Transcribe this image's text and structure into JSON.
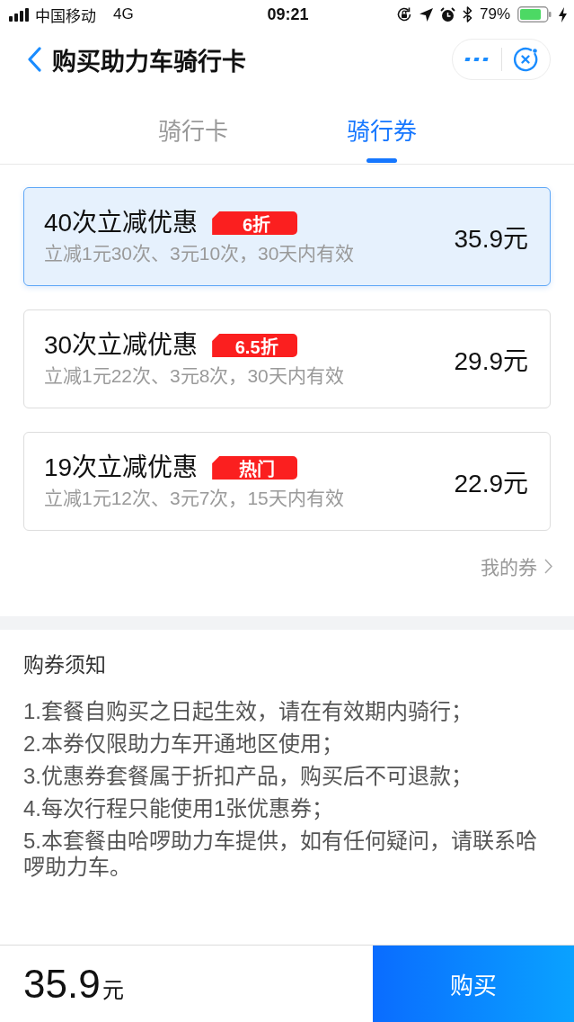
{
  "status_bar": {
    "carrier": "中国移动",
    "network": "4G",
    "time": "09:21",
    "battery": "79%"
  },
  "header": {
    "title": "购买助力车骑行卡"
  },
  "tabs": [
    {
      "label": "骑行卡",
      "selected": false
    },
    {
      "label": "骑行券",
      "selected": true
    }
  ],
  "packages": [
    {
      "title": "40次立减优惠",
      "badge": "6折",
      "description": "立减1元30次、3元10次，30天内有效",
      "price": "35.9元",
      "selected": true
    },
    {
      "title": "30次立减优惠",
      "badge": "6.5折",
      "description": "立减1元22次、3元8次，30天内有效",
      "price": "29.9元",
      "selected": false
    },
    {
      "title": "19次立减优惠",
      "badge": "热门",
      "description": "立减1元12次、3元7次，15天内有效",
      "price": "22.9元",
      "selected": false
    }
  ],
  "my_coupons_link": "我的券",
  "notice": {
    "title": "购券须知",
    "items": [
      "1.套餐自购买之日起生效，请在有效期内骑行；",
      "2.本券仅限助力车开通地区使用；",
      "3.优惠券套餐属于折扣产品，购买后不可退款；",
      "4.每次行程只能使用1张优惠券；",
      "5.本套餐由哈啰助力车提供，如有任何疑问，请联系哈啰助力车。"
    ]
  },
  "footer": {
    "price": "35.9",
    "unit": "元",
    "buy_button": "购买"
  }
}
